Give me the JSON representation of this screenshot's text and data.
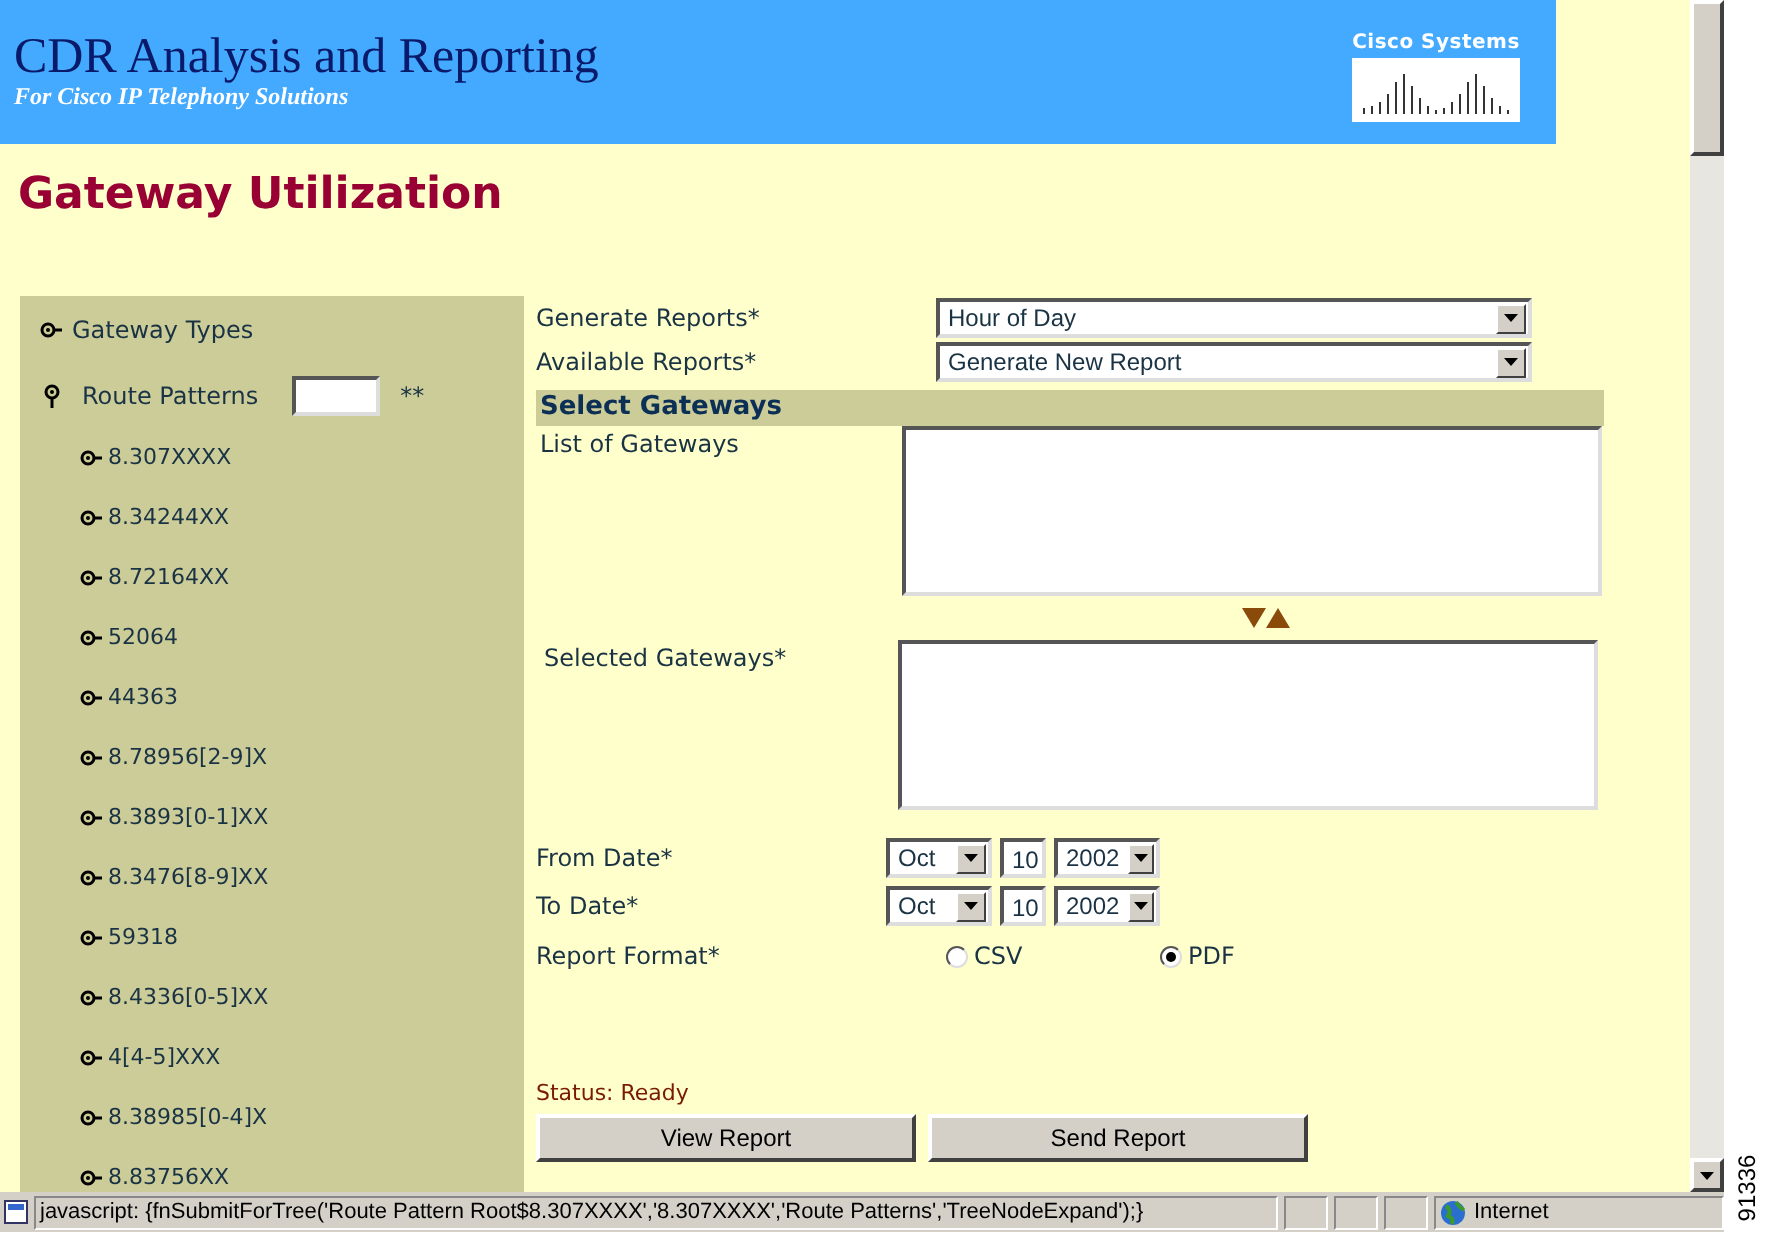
{
  "header": {
    "title": "CDR Analysis and Reporting",
    "subtitle": "For Cisco IP Telephony Solutions",
    "logo_text": "Cisco Systems"
  },
  "page_title": "Gateway Utilization",
  "tree": {
    "items": [
      {
        "label": "Gateway Types",
        "expanded": false
      },
      {
        "label": "Route Patterns",
        "expanded": true,
        "filter_note": "**",
        "children": [
          {
            "label": "8.307XXXX"
          },
          {
            "label": "8.34244XX"
          },
          {
            "label": "8.72164XX"
          },
          {
            "label": "52064"
          },
          {
            "label": "44363"
          },
          {
            "label": "8.78956[2-9]X"
          },
          {
            "label": "8.3893[0-1]XX"
          },
          {
            "label": "8.3476[8-9]XX"
          },
          {
            "label": "59318"
          },
          {
            "label": "8.4336[0-5]XX"
          },
          {
            "label": "4[4-5]XXX"
          },
          {
            "label": "8.38985[0-4]X"
          },
          {
            "label": "8.83756XX"
          }
        ]
      }
    ]
  },
  "form": {
    "generate_reports": {
      "label": "Generate Reports*",
      "value": "Hour of Day"
    },
    "available_reports": {
      "label": "Available Reports*",
      "value": "Generate New Report"
    },
    "section_title": "Select Gateways",
    "list_of_gateways": {
      "label": "List of Gateways"
    },
    "selected_gateways": {
      "label": "Selected Gateways*"
    },
    "from_date": {
      "label": "From Date*",
      "month": "Oct",
      "day": "10",
      "year": "2002"
    },
    "to_date": {
      "label": "To Date*",
      "month": "Oct",
      "day": "10",
      "year": "2002"
    },
    "report_format": {
      "label": "Report Format*",
      "options": [
        {
          "label": "CSV",
          "selected": false
        },
        {
          "label": "PDF",
          "selected": true
        }
      ]
    },
    "status": "Status: Ready",
    "buttons": [
      "View Report",
      "Send Report"
    ]
  },
  "status_bar": {
    "text": "javascript: {fnSubmitForTree('Route Pattern Root$8.307XXXX','8.307XXXX','Route Patterns','TreeNodeExpand');}",
    "zone": "Internet"
  },
  "figure_id": "91336"
}
